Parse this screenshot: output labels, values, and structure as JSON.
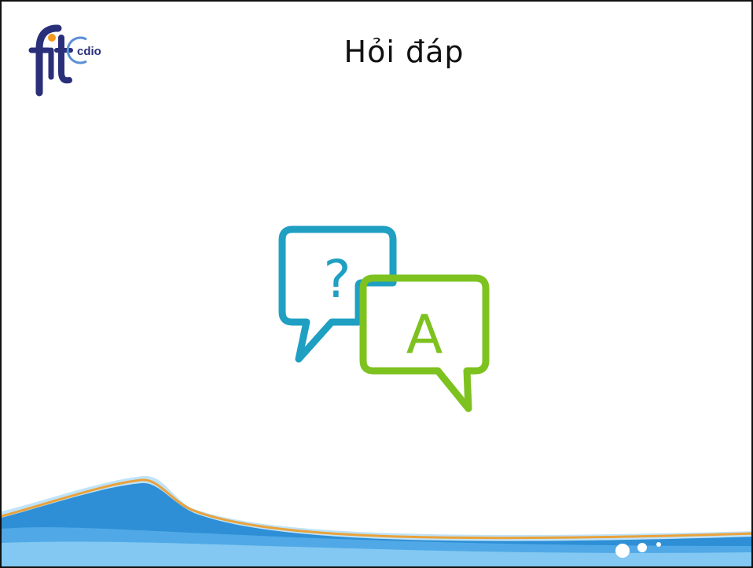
{
  "slide": {
    "title": "Hỏi đáp",
    "logo": {
      "text": "cdio",
      "mark": "fit"
    }
  },
  "icons": {
    "question_bubble": "question-bubble-icon",
    "answer_bubble": "answer-bubble-icon",
    "question_glyph": "?",
    "answer_glyph": "A"
  },
  "colors": {
    "question": "#1FA0C2",
    "answer": "#7DC21F",
    "logo_navy": "#2A2F7A",
    "logo_orange": "#F39A1E",
    "wave_blue": "#2E8FD6",
    "wave_light": "#BFE3FA",
    "wave_orange": "#E9A23B"
  }
}
